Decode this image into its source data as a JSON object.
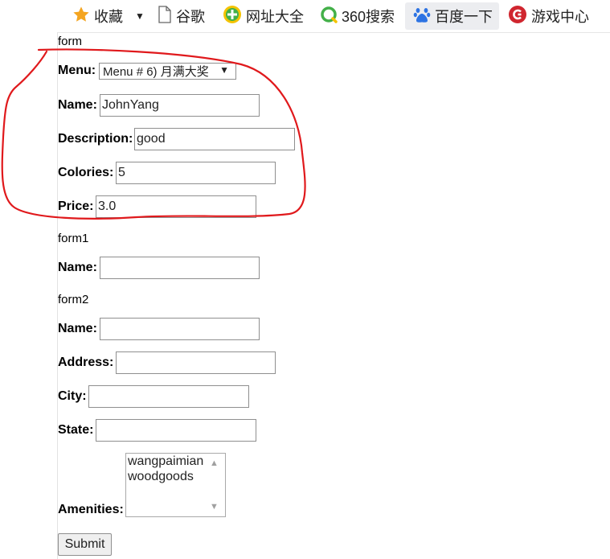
{
  "bookmarks": [
    {
      "icon": "star-icon",
      "label": "收藏"
    },
    {
      "icon": "dropdown-arrow-icon",
      "label": ""
    },
    {
      "icon": "page-icon",
      "label": "谷歌"
    },
    {
      "icon": "plus-circle-icon",
      "label": "网址大全"
    },
    {
      "icon": "search-360-icon",
      "label": "360搜索"
    },
    {
      "icon": "baidu-paw-icon",
      "label": "百度一下"
    },
    {
      "icon": "game-icon",
      "label": "游戏中心"
    }
  ],
  "form": {
    "heading": "form",
    "menu_label": "Menu:",
    "menu_value": "Menu # 6) 月满大奖",
    "name_label": "Name:",
    "name_value": "JohnYang",
    "description_label": "Description:",
    "description_value": "good",
    "colories_label": "Colories:",
    "colories_value": "5",
    "price_label": "Price:",
    "price_value": "3.0"
  },
  "form1": {
    "heading": "form1",
    "name_label": "Name:",
    "name_value": ""
  },
  "form2": {
    "heading": "form2",
    "name_label": "Name:",
    "address_label": "Address:",
    "city_label": "City:",
    "state_label": "State:",
    "amenities_label": "Amenities:",
    "amenities_options": [
      "wangpaimian",
      "woodgoods"
    ],
    "submit_label": "Submit"
  },
  "colors": {
    "annotation": "#e0191c",
    "star": "#f4a521",
    "plus_green": "#43b049",
    "baidu_blue": "#2d73e3",
    "game_red": "#d0262f"
  }
}
